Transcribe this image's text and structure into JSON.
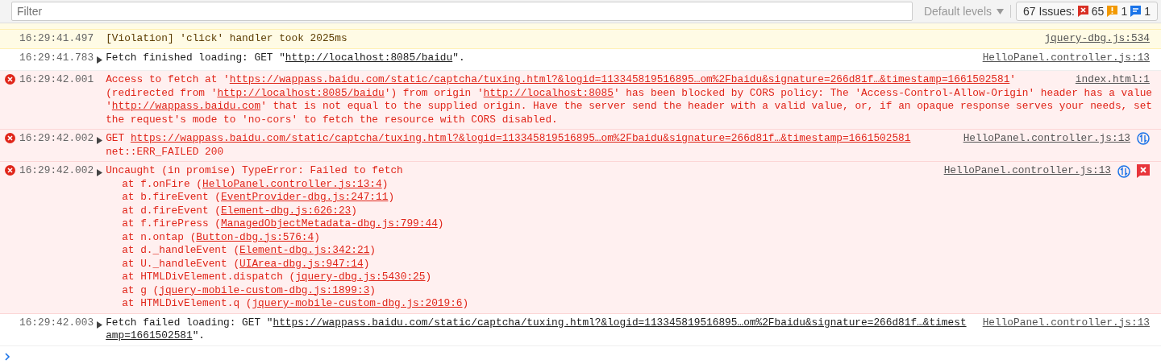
{
  "toolbar": {
    "filter": {
      "placeholder": "Filter"
    },
    "levels": "Default levels",
    "issues": {
      "label": "67 Issues:",
      "counts": [
        {
          "kind": "error",
          "count": "65"
        },
        {
          "kind": "warning",
          "count": "1"
        },
        {
          "kind": "info",
          "count": "1"
        }
      ]
    }
  },
  "rows": [
    {
      "kind": "violation",
      "time": "16:29:41.497",
      "arrow": false,
      "source": "jquery-dbg.js:534",
      "actions": [],
      "lines": [
        {
          "indent": false,
          "parts": [
            {
              "t": "[Violation] 'click' handler took 2025ms",
              "link": false
            }
          ]
        }
      ]
    },
    {
      "kind": "info",
      "time": "16:29:41.783",
      "arrow": true,
      "source": "HelloPanel.controller.js:13",
      "actions": [],
      "lines": [
        {
          "indent": false,
          "parts": [
            {
              "t": "Fetch finished loading: GET \"",
              "link": false
            },
            {
              "t": "http://localhost:8085/baidu",
              "link": true
            },
            {
              "t": "\".",
              "link": false
            }
          ]
        }
      ]
    },
    {
      "kind": "error",
      "time": "16:29:42.001",
      "arrow": false,
      "source": "index.html:1",
      "actions": [],
      "lines": [
        {
          "indent": false,
          "parts": [
            {
              "t": "Access to fetch at '",
              "link": false
            },
            {
              "t": "https://wappass.baidu.com/static/captcha/tuxing.html?&logid=113345819516895…om%2Fbaidu&signature=266d81f…&timestamp=1661502581",
              "link": true
            },
            {
              "t": "'",
              "link": false
            }
          ]
        },
        {
          "indent": false,
          "parts": [
            {
              "t": "(redirected from '",
              "link": false
            },
            {
              "t": "http://localhost:8085/baidu",
              "link": true
            },
            {
              "t": "') from origin '",
              "link": false
            },
            {
              "t": "http://localhost:8085",
              "link": true
            },
            {
              "t": "' has been blocked by CORS policy: The 'Access-Control-Allow-Origin' header has a value",
              "link": false
            }
          ]
        },
        {
          "indent": false,
          "parts": [
            {
              "t": "'",
              "link": false
            },
            {
              "t": "http://wappass.baidu.com",
              "link": true
            },
            {
              "t": "' that is not equal to the supplied origin. Have the server send the header with a valid value, or, if an opaque response serves your needs, set",
              "link": false
            }
          ]
        },
        {
          "indent": false,
          "parts": [
            {
              "t": "the request's mode to 'no-cors' to fetch the resource with CORS disabled.",
              "link": false
            }
          ]
        }
      ]
    },
    {
      "kind": "error",
      "time": "16:29:42.002",
      "arrow": true,
      "source": "HelloPanel.controller.js:13",
      "actions": [
        {
          "kind": "network"
        }
      ],
      "lines": [
        {
          "indent": false,
          "parts": [
            {
              "t": "GET ",
              "link": false
            },
            {
              "t": "https://wappass.baidu.com/static/captcha/tuxing.html?&logid=113345819516895…om%2Fbaidu&signature=266d81f…&timestamp=1661502581",
              "link": true
            }
          ]
        },
        {
          "indent": false,
          "parts": [
            {
              "t": "net::ERR_FAILED 200",
              "link": false
            }
          ]
        }
      ]
    },
    {
      "kind": "error",
      "time": "16:29:42.002",
      "arrow": true,
      "source": "HelloPanel.controller.js:13",
      "actions": [
        {
          "kind": "network"
        },
        {
          "kind": "issue"
        }
      ],
      "lines": [
        {
          "indent": false,
          "parts": [
            {
              "t": "Uncaught (in promise) TypeError: Failed to fetch",
              "link": false
            }
          ]
        },
        {
          "indent": true,
          "parts": [
            {
              "t": "at f.onFire (",
              "link": false
            },
            {
              "t": "HelloPanel.controller.js:13:4",
              "link": true
            },
            {
              "t": ")",
              "link": false
            }
          ]
        },
        {
          "indent": true,
          "parts": [
            {
              "t": "at b.fireEvent (",
              "link": false
            },
            {
              "t": "EventProvider-dbg.js:247:11",
              "link": true
            },
            {
              "t": ")",
              "link": false
            }
          ]
        },
        {
          "indent": true,
          "parts": [
            {
              "t": "at d.fireEvent (",
              "link": false
            },
            {
              "t": "Element-dbg.js:626:23",
              "link": true
            },
            {
              "t": ")",
              "link": false
            }
          ]
        },
        {
          "indent": true,
          "parts": [
            {
              "t": "at f.firePress (",
              "link": false
            },
            {
              "t": "ManagedObjectMetadata-dbg.js:799:44",
              "link": true
            },
            {
              "t": ")",
              "link": false
            }
          ]
        },
        {
          "indent": true,
          "parts": [
            {
              "t": "at n.ontap (",
              "link": false
            },
            {
              "t": "Button-dbg.js:576:4",
              "link": true
            },
            {
              "t": ")",
              "link": false
            }
          ]
        },
        {
          "indent": true,
          "parts": [
            {
              "t": "at d._handleEvent (",
              "link": false
            },
            {
              "t": "Element-dbg.js:342:21",
              "link": true
            },
            {
              "t": ")",
              "link": false
            }
          ]
        },
        {
          "indent": true,
          "parts": [
            {
              "t": "at U._handleEvent (",
              "link": false
            },
            {
              "t": "UIArea-dbg.js:947:14",
              "link": true
            },
            {
              "t": ")",
              "link": false
            }
          ]
        },
        {
          "indent": true,
          "parts": [
            {
              "t": "at HTMLDivElement.dispatch (",
              "link": false
            },
            {
              "t": "jquery-dbg.js:5430:25",
              "link": true
            },
            {
              "t": ")",
              "link": false
            }
          ]
        },
        {
          "indent": true,
          "parts": [
            {
              "t": "at g (",
              "link": false
            },
            {
              "t": "jquery-mobile-custom-dbg.js:1899:3",
              "link": true
            },
            {
              "t": ")",
              "link": false
            }
          ]
        },
        {
          "indent": true,
          "parts": [
            {
              "t": "at HTMLDivElement.q (",
              "link": false
            },
            {
              "t": "jquery-mobile-custom-dbg.js:2019:6",
              "link": true
            },
            {
              "t": ")",
              "link": false
            }
          ]
        }
      ]
    },
    {
      "kind": "info",
      "time": "16:29:42.003",
      "arrow": true,
      "source": "HelloPanel.controller.js:13",
      "actions": [],
      "lines": [
        {
          "indent": false,
          "parts": [
            {
              "t": "Fetch failed loading: GET \"",
              "link": false
            },
            {
              "t": "https://wappass.baidu.com/static/captcha/tuxing.html?&logid=113345819516895…om%2Fbaidu&signature=266d81f…&timest",
              "link": true
            }
          ]
        },
        {
          "indent": false,
          "parts": [
            {
              "t": "amp=1661502581",
              "link": true
            },
            {
              "t": "\".",
              "link": false
            }
          ]
        }
      ]
    }
  ]
}
